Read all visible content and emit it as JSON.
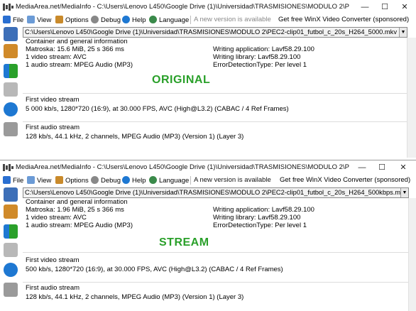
{
  "windows": [
    {
      "title": "MediaArea.net/MediaInfo - C:\\Users\\Lenovo L450\\Google Drive (1)\\Universidad\\TRASMISIONES\\MODULO 2\\PEC2-clip0...",
      "menu": {
        "file": "File",
        "view": "View",
        "options": "Options",
        "debug": "Debug",
        "help": "Help",
        "language": "Language",
        "new_version": "A new version is available",
        "sponsor": "Get free WinX Video Converter (sponsored)"
      },
      "file_path": "C:\\Users\\Lenovo L450\\Google Drive (1)\\Universidad\\TRASMISIONES\\MODULO 2\\PEC2-clip01_futbol_c_20s_H264_5000.mkv",
      "general": {
        "title": "Container and general information",
        "left": [
          "Matroska: 15.6 MiB, 25 s 366 ms",
          "1 video stream: AVC",
          "1 audio stream: MPEG Audio (MP3)"
        ],
        "right": [
          "Writing application: Lavf58.29.100",
          "Writing library: Lavf58.29.100",
          "ErrorDetectionType: Per level 1"
        ]
      },
      "label": "ORIGINAL",
      "video": {
        "title": "First video stream",
        "info": "5 000 kb/s, 1280*720 (16:9), at 30.000 FPS, AVC (High@L3.2) (CABAC / 4 Ref Frames)"
      },
      "audio": {
        "title": "First audio stream",
        "info": "128 kb/s, 44.1 kHz, 2 channels, MPEG Audio (MP3) (Version 1) (Layer 3)"
      }
    },
    {
      "title": "MediaArea.net/MediaInfo - C:\\Users\\Lenovo L450\\Google Drive (1)\\Universidad\\TRASMISIONES\\MODULO 2\\PEC2-clip0...",
      "menu": {
        "file": "File",
        "view": "View",
        "options": "Options",
        "debug": "Debug",
        "help": "Help",
        "language": "Language",
        "new_version": "A new version is available",
        "sponsor": "Get free WinX Video Converter (sponsored)"
      },
      "file_path": "C:\\Users\\Lenovo L450\\Google Drive (1)\\Universidad\\TRASMISIONES\\MODULO 2\\PEC2-clip01_futbol_c_20s_H264_500kbps.mkv",
      "general": {
        "title": "Container and general information",
        "left": [
          "Matroska: 1.96 MiB, 25 s 366 ms",
          "1 video stream: AVC",
          "1 audio stream: MPEG Audio (MP3)"
        ],
        "right": [
          "Writing application: Lavf58.29.100",
          "Writing library: Lavf58.29.100",
          "ErrorDetectionType: Per level 1"
        ]
      },
      "label": "STREAM",
      "video": {
        "title": "First video stream",
        "info": "500 kb/s, 1280*720 (16:9), at 30.000 FPS, AVC (High@L3.2) (CABAC / 4 Ref Frames)"
      },
      "audio": {
        "title": "First audio stream",
        "info": "128 kb/s, 44.1 kHz, 2 channels, MPEG Audio (MP3) (Version 1) (Layer 3)"
      }
    }
  ],
  "window_controls": {
    "minimize": "—",
    "maximize": "☐",
    "close": "✕"
  },
  "colors": {
    "label_green": "#2aa02a",
    "accent_blue": "#1e78d2"
  },
  "icons": [
    "mediainfo-app-icon",
    "file-menu-icon",
    "view-menu-icon",
    "options-menu-icon",
    "debug-menu-icon",
    "help-menu-icon",
    "language-menu-icon",
    "open-file-icon",
    "open-folder-icon",
    "export-icon",
    "tools-icon",
    "info-icon",
    "preferences-icon"
  ]
}
